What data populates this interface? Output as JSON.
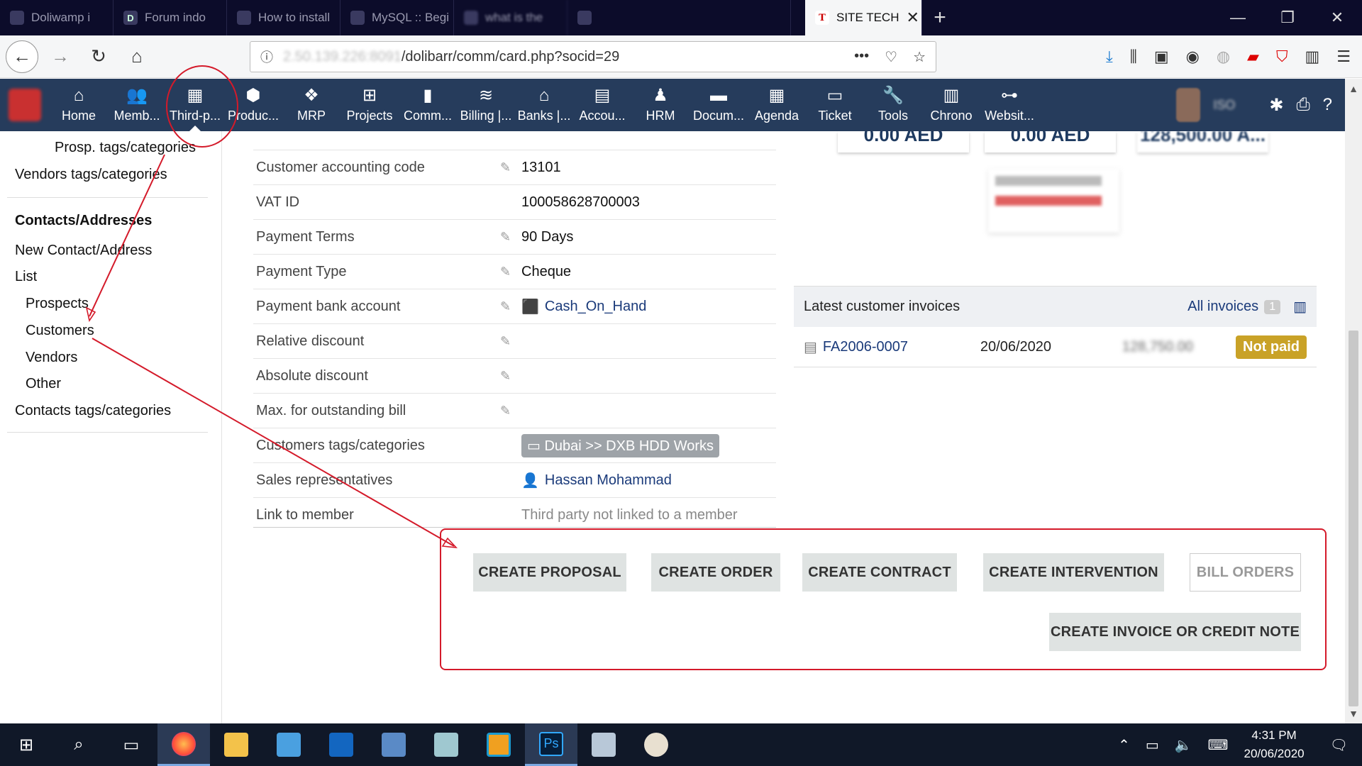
{
  "browser": {
    "tabs": [
      {
        "title": "Doliwamp i"
      },
      {
        "title": "Forum indo"
      },
      {
        "title": "How to install"
      },
      {
        "title": "MySQL :: Begi"
      },
      {
        "title": "what is the"
      },
      {
        "title": ""
      }
    ],
    "active_tab": {
      "title": "SITE TECH"
    },
    "url_hidden": "2.50.139.226:8091",
    "url_visible": "/dolibarr/comm/card.php?socid=29"
  },
  "topmenu": {
    "items": [
      {
        "label": "Home",
        "icon": "home-icon"
      },
      {
        "label": "Memb...",
        "icon": "members-icon"
      },
      {
        "label": "Third-p...",
        "icon": "building-icon"
      },
      {
        "label": "Produc...",
        "icon": "box-icon"
      },
      {
        "label": "MRP",
        "icon": "cubes-icon"
      },
      {
        "label": "Projects",
        "icon": "sitemap-icon"
      },
      {
        "label": "Comm...",
        "icon": "suitcase-icon"
      },
      {
        "label": "Billing |...",
        "icon": "coins-icon"
      },
      {
        "label": "Banks |...",
        "icon": "bank-icon"
      },
      {
        "label": "Accou...",
        "icon": "money-check-icon"
      },
      {
        "label": "HRM",
        "icon": "user-tie-icon"
      },
      {
        "label": "Docum...",
        "icon": "folder-icon"
      },
      {
        "label": "Agenda",
        "icon": "calendar-icon"
      },
      {
        "label": "Ticket",
        "icon": "ticket-icon"
      },
      {
        "label": "Tools",
        "icon": "wrench-icon"
      },
      {
        "label": "Chrono",
        "icon": "chrono-icon"
      },
      {
        "label": "Websit...",
        "icon": "network-icon"
      }
    ],
    "user_login": "ISO"
  },
  "sidebar": {
    "prosp_tags": "Prosp. tags/categories",
    "vendors_tags": "Vendors tags/categories",
    "contacts_heading": "Contacts/Addresses",
    "new_contact": "New Contact/Address",
    "list": "List",
    "prospects": "Prospects",
    "customers": "Customers",
    "vendors": "Vendors",
    "other": "Other",
    "contacts_tags": "Contacts tags/categories"
  },
  "fields": [
    {
      "label": "Customer accounting code",
      "value": "13101"
    },
    {
      "label": "VAT ID",
      "value": "100058628700003"
    },
    {
      "label": "Payment Terms",
      "value": "90 Days"
    },
    {
      "label": "Payment Type",
      "value": "Cheque"
    },
    {
      "label": "Payment bank account",
      "value": "Cash_On_Hand"
    },
    {
      "label": "Relative discount",
      "value": ""
    },
    {
      "label": "Absolute discount",
      "value": ""
    },
    {
      "label": "Max. for outstanding bill",
      "value": ""
    },
    {
      "label": "Customers tags/categories",
      "value": "Dubai >> DXB HDD Works"
    },
    {
      "label": "Sales representatives",
      "value": "Hassan Mohammad"
    },
    {
      "label": "Link to member",
      "value": "Third party not linked to a member"
    }
  ],
  "stats": [
    "0.00 AED",
    "0.00 AED",
    "128,500.00 A..."
  ],
  "invoices": {
    "title": "Latest customer invoices",
    "all_label": "All invoices",
    "count": "1",
    "rows": [
      {
        "ref": "FA2006-0007",
        "date": "20/06/2020",
        "amount": "128,750.00",
        "status": "Not paid"
      }
    ]
  },
  "actions": {
    "create_proposal": "CREATE PROPOSAL",
    "create_order": "CREATE ORDER",
    "create_contract": "CREATE CONTRACT",
    "create_intervention": "CREATE INTERVENTION",
    "bill_orders": "BILL ORDERS",
    "create_invoice": "CREATE INVOICE OR CREDIT NOTE"
  },
  "taskbar": {
    "time": "4:31 PM",
    "date": "20/06/2020"
  },
  "colors": {
    "menu_bg": "#263c5c",
    "annotation_red": "#d41a2a",
    "not_paid": "#c9a227"
  }
}
